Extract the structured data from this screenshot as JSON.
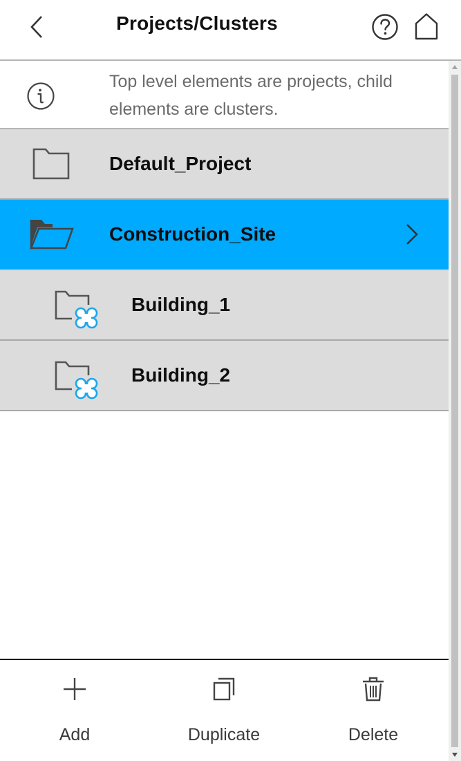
{
  "header": {
    "title": "Projects/Clusters",
    "back_icon": "chevron-left-icon",
    "help_icon": "question-circle-icon",
    "home_icon": "home-icon"
  },
  "info": {
    "text": "Top level elements are projects, child elements are clusters.",
    "icon": "info-icon"
  },
  "items": [
    {
      "label": "Default_Project",
      "kind": "project",
      "icon": "folder-icon",
      "selected": false
    },
    {
      "label": "Construction_Site",
      "kind": "project",
      "icon": "folder-open-icon",
      "selected": true
    },
    {
      "label": "Building_1",
      "kind": "cluster",
      "icon": "cluster-folder-icon",
      "selected": false
    },
    {
      "label": "Building_2",
      "kind": "cluster",
      "icon": "cluster-folder-icon",
      "selected": false
    }
  ],
  "toolbar": {
    "add_label": "Add",
    "duplicate_label": "Duplicate",
    "delete_label": "Delete"
  },
  "colors": {
    "selected": "#00aaff",
    "row_background": "#dcdcdc",
    "cluster_accent": "#1aa7ec",
    "icon_gray": "#555555"
  }
}
